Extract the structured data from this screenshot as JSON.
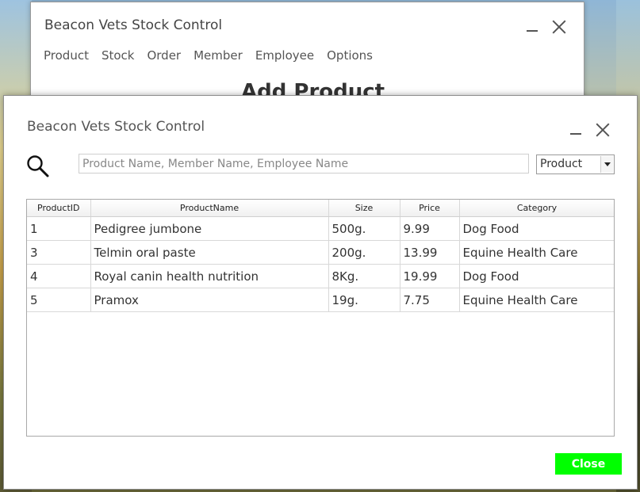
{
  "background_window": {
    "title": "Beacon Vets Stock Control",
    "menu": [
      "Product",
      "Stock",
      "Order",
      "Member",
      "Employee",
      "Options"
    ],
    "heading": "Add Product"
  },
  "dialog": {
    "title": "Beacon Vets Stock Control",
    "search": {
      "value": "",
      "placeholder": "Product Name, Member Name, Employee Name"
    },
    "filter_select": {
      "selected": "Product"
    },
    "table": {
      "columns": [
        "ProductID",
        "ProductName",
        "Size",
        "Price",
        "Category"
      ],
      "rows": [
        [
          "1",
          "Pedigree jumbone",
          "500g.",
          "9.99",
          "Dog Food"
        ],
        [
          "3",
          "Telmin oral paste",
          "200g.",
          "13.99",
          "Equine Health Care"
        ],
        [
          "4",
          "Royal canin health nutrition",
          "8Kg.",
          "19.99",
          "Dog Food"
        ],
        [
          "5",
          "Pramox",
          "19g.",
          "7.75",
          "Equine Health Care"
        ]
      ]
    },
    "close_label": "Close",
    "close_color": "#00ff00"
  }
}
